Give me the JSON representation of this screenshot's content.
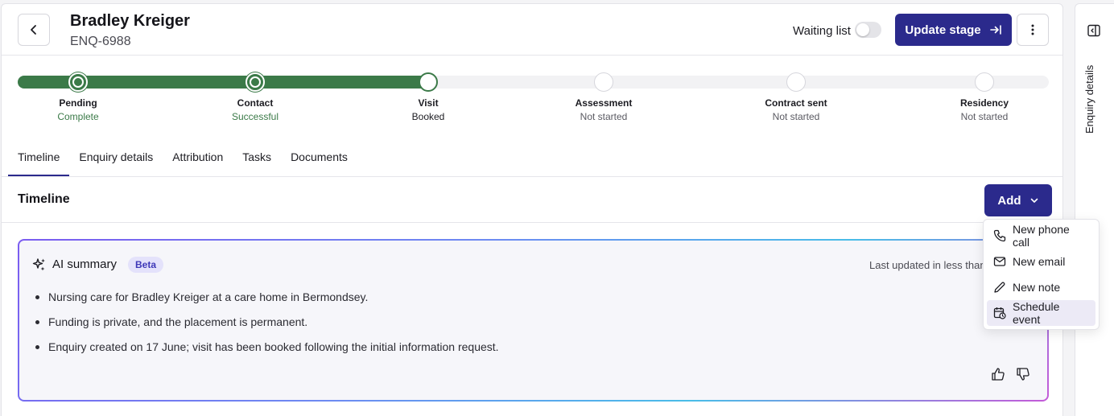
{
  "header": {
    "name": "Bradley Kreiger",
    "enquiry_id": "ENQ-6988",
    "waiting_list_label": "Waiting list",
    "waiting_list_on": false,
    "update_stage_label": "Update stage"
  },
  "stages": [
    {
      "name": "Pending",
      "status": "Complete",
      "state": "done"
    },
    {
      "name": "Contact",
      "status": "Successful",
      "state": "done"
    },
    {
      "name": "Visit",
      "status": "Booked",
      "state": "current"
    },
    {
      "name": "Assessment",
      "status": "Not started",
      "state": "todo"
    },
    {
      "name": "Contract sent",
      "status": "Not started",
      "state": "todo"
    },
    {
      "name": "Residency",
      "status": "Not started",
      "state": "todo"
    }
  ],
  "tabs": [
    {
      "label": "Timeline",
      "active": true
    },
    {
      "label": "Enquiry details",
      "active": false
    },
    {
      "label": "Attribution",
      "active": false
    },
    {
      "label": "Tasks",
      "active": false
    },
    {
      "label": "Documents",
      "active": false
    }
  ],
  "timeline": {
    "title": "Timeline",
    "add_label": "Add"
  },
  "add_menu": [
    {
      "label": "New phone call",
      "icon": "phone-icon"
    },
    {
      "label": "New email",
      "icon": "mail-icon"
    },
    {
      "label": "New note",
      "icon": "pencil-icon"
    },
    {
      "label": "Schedule event",
      "icon": "calendar-clock-icon",
      "highlighted": true
    }
  ],
  "ai_summary": {
    "title": "AI summary",
    "badge": "Beta",
    "updated": "Last updated in less than",
    "points": [
      "Nursing care for Bradley Kreiger at a care home in Bermondsey.",
      "Funding is private, and the placement is permanent.",
      "Enquiry created on 17 June; visit has been booked following the initial information request."
    ]
  },
  "right_rail": {
    "label": "Enquiry details"
  },
  "colors": {
    "primary": "#2b2a8c",
    "progress": "#3b7a48",
    "badge_bg": "#e4e2fb"
  }
}
